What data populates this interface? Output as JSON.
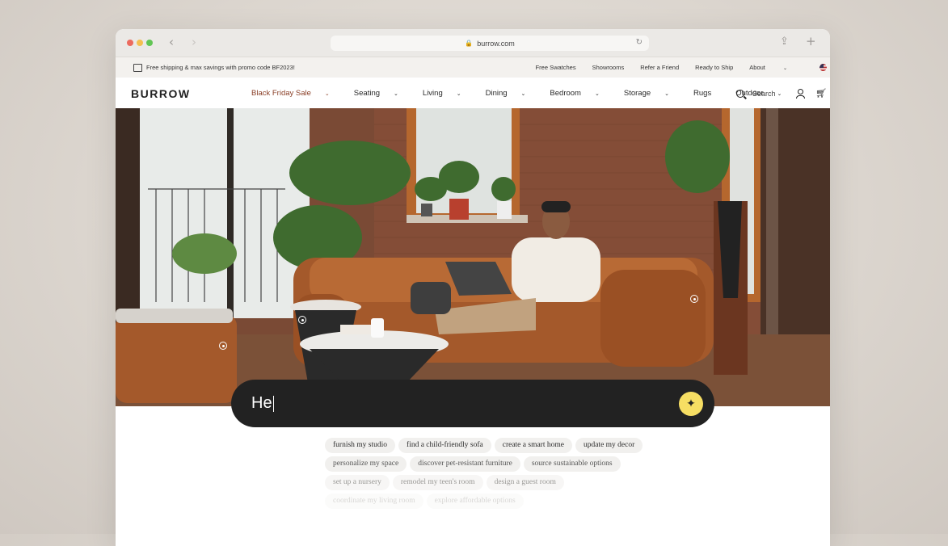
{
  "browser": {
    "url": "burrow.com"
  },
  "promo_bar": {
    "shipping_text": "Free shipping & max savings with promo code BF2023!",
    "links": [
      "Free Swatches",
      "Showrooms",
      "Refer a Friend",
      "Ready to Ship",
      "About"
    ]
  },
  "header": {
    "logo": "BURROW",
    "nav": [
      {
        "label": "Black Friday Sale",
        "dropdown": true
      },
      {
        "label": "Seating",
        "dropdown": true
      },
      {
        "label": "Living",
        "dropdown": true
      },
      {
        "label": "Dining",
        "dropdown": true
      },
      {
        "label": "Bedroom",
        "dropdown": true
      },
      {
        "label": "Storage",
        "dropdown": true
      },
      {
        "label": "Rugs",
        "dropdown": false
      },
      {
        "label": "Outdoor",
        "dropdown": true
      }
    ],
    "search_label": "Search",
    "sale_color": "#8a3f27"
  },
  "prompt": {
    "value": "He",
    "button_icon": "sparkle-icon",
    "accent": "#f6de63"
  },
  "suggestions": {
    "rows": [
      [
        "furnish my studio",
        "find a child-friendly sofa",
        "create a smart home",
        "update my decor"
      ],
      [
        "personalize my space",
        "discover pet-resistant furniture",
        "source sustainable options"
      ],
      [
        "set up a nursery",
        "remodel my teen's room",
        "design a guest room"
      ],
      [
        "coordinate my living room",
        "explore affordable options"
      ]
    ]
  }
}
